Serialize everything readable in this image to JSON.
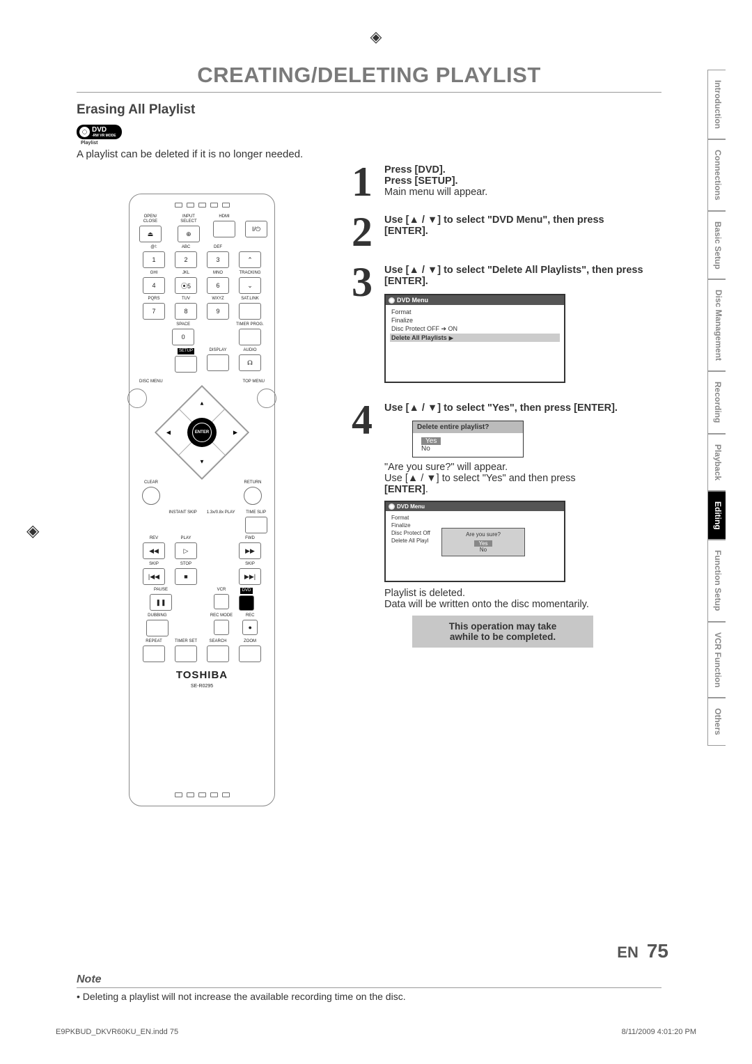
{
  "title": "CREATING/DELETING PLAYLIST",
  "subhead": "Erasing All Playlist",
  "badge": {
    "main": "DVD",
    "sub1": "-RW",
    "sub2": "VR MODE",
    "sub3": "Playlist"
  },
  "intro": "A playlist can be deleted if it is no longer needed.",
  "remote": {
    "brand": "TOSHIBA",
    "model": "SE-R0295",
    "labels": {
      "open_close": "OPEN/\nCLOSE",
      "input_select": "INPUT\nSELECT",
      "hdmi": "HDMI",
      "abc": "ABC",
      "def": "DEF",
      "ghi": "GHI",
      "jkl": "JKL",
      "mno": "MNO",
      "pqrs": "PQRS",
      "tuv": "TUV",
      "wxyz": "WXYZ",
      "tracking": "TRACKING",
      "sat_link": "SAT.LINK",
      "timer_prog": "TIMER\nPROG.",
      "space": "SPACE",
      "setup": "SETUP",
      "display": "DISPLAY",
      "audio": "AUDIO",
      "disc_menu": "DISC MENU",
      "top_menu": "TOP MENU",
      "enter": "ENTER",
      "clear": "CLEAR",
      "return": "RETURN",
      "instant_skip": "INSTANT\nSKIP",
      "play_13": "1.3x/0.8x\nPLAY",
      "time_slip": "TIME SLIP",
      "rev": "REV",
      "play_lbl": "PLAY",
      "fwd": "FWD",
      "skip": "SKIP",
      "stop": "STOP",
      "pause": "PAUSE",
      "vcr": "VCR",
      "dvd": "DVD",
      "dubbing": "DUBBING",
      "rec_mode": "REC MODE",
      "rec": "REC",
      "repeat": "REPEAT",
      "timer_set": "TIMER SET",
      "search": "SEARCH",
      "zoom": "ZOOM"
    }
  },
  "steps": {
    "s1": {
      "num": "1",
      "l1": "Press [DVD].",
      "l2": "Press [SETUP].",
      "l3": "Main menu will appear."
    },
    "s2": {
      "num": "2",
      "text": "Use [▲ / ▼] to select \"DVD Menu\", then press [ENTER]."
    },
    "s3": {
      "num": "3",
      "text": "Use [▲ / ▼] to select \"Delete All Playlists\", then press [ENTER].",
      "menu": {
        "title": "DVD Menu",
        "items": [
          "Format",
          "Finalize",
          "Disc Protect OFF ➔ ON",
          "Delete All Playlists"
        ]
      }
    },
    "s4": {
      "num": "4",
      "text": "Use [▲ / ▼] to select \"Yes\", then press [ENTER].",
      "confirm": {
        "q": "Delete entire playlist?",
        "yes": "Yes",
        "no": "No"
      },
      "after1": "\"Are you sure?\" will appear.",
      "after2": "Use [▲ / ▼] to select \"Yes\" and then press",
      "after3": "[ENTER]",
      "menu2": {
        "title": "DVD Menu",
        "items": [
          "Format",
          "Finalize",
          "Disc Protect Off",
          "Delete All Playl"
        ],
        "popup": {
          "q": "Are you sure?",
          "yes": "Yes",
          "no": "No"
        }
      },
      "done1": "Playlist is deleted.",
      "done2": "Data will be written onto the disc momentarily.",
      "grey1": "This operation may take",
      "grey2": "awhile to be completed."
    }
  },
  "note": {
    "title": "Note",
    "text": "Deleting a playlist will not increase the available recording time on the disc."
  },
  "tabs": [
    "Introduction",
    "Connections",
    "Basic Setup",
    "Disc\nManagement",
    "Recording",
    "Playback",
    "Editing",
    "Function Setup",
    "VCR Function",
    "Others"
  ],
  "active_tab": 6,
  "footer": {
    "lang": "EN",
    "page": "75"
  },
  "foot_left": "E9PKBUD_DKVR60KU_EN.indd   75",
  "foot_right": "8/11/2009   4:01:20 PM"
}
